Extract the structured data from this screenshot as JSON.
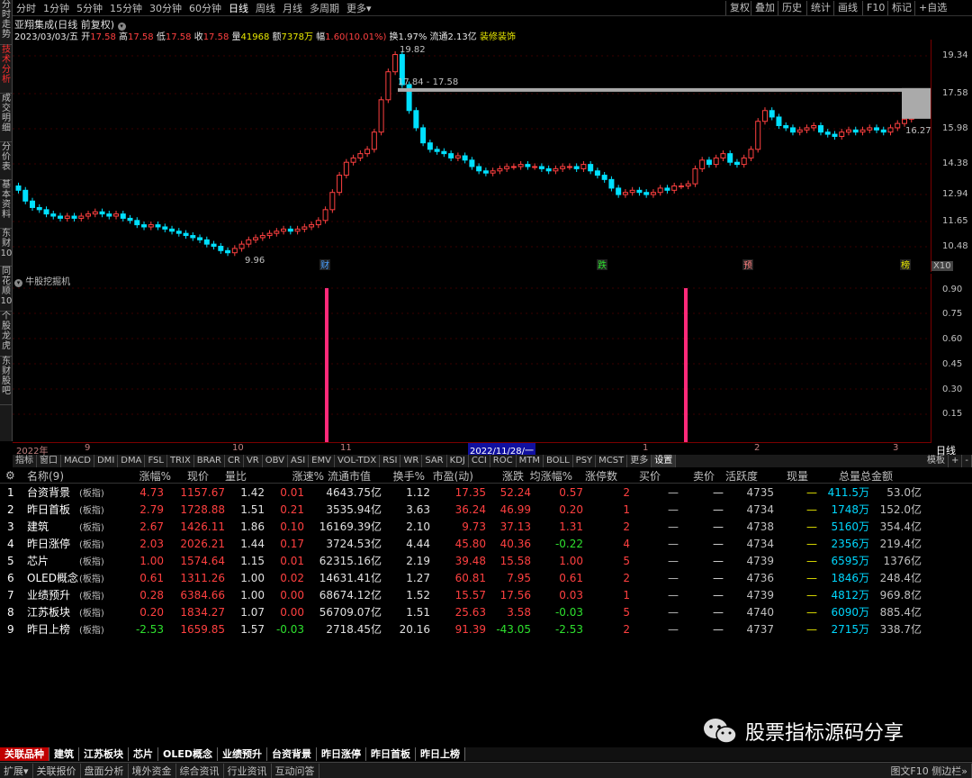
{
  "left_tabs": [
    "分时走势",
    "技术分析",
    "成交明细",
    "分价表",
    "基本资料",
    "东财10",
    "同花顺10",
    "个股龙虎",
    "东财股吧"
  ],
  "toolbar": {
    "periods": [
      "分时",
      "1分钟",
      "5分钟",
      "15分钟",
      "30分钟",
      "60分钟",
      "日线",
      "周线",
      "月线",
      "多周期",
      "更多▾"
    ],
    "active": "日线",
    "right": [
      "复权",
      "叠加",
      "历史",
      "统计",
      "画线",
      "F10",
      "标记",
      "+自选"
    ]
  },
  "stock": {
    "title": "亚翔集成(日线 前复权)",
    "date": "2023/03/03/五",
    "open_l": "开",
    "open": "17.58",
    "high_l": "高",
    "high": "17.58",
    "low_l": "低",
    "low": "17.58",
    "close_l": "收",
    "close": "17.58",
    "vol_l": "量",
    "vol": "41968",
    "amt_l": "额",
    "amt": "7378万",
    "chg_l": "幅",
    "chg": "1.60(10.01%)",
    "turn_l": "换",
    "turn": "1.97%",
    "float_l": "流通",
    "float": "2.13亿",
    "sector": "装修装饰"
  },
  "price_axis": [
    "19.34",
    "17.58",
    "15.98",
    "14.38",
    "12.94",
    "11.65",
    "10.48",
    "X10"
  ],
  "annotations": {
    "high": "19.82",
    "low": "9.96",
    "range": "17.84 - 17.58",
    "last": "16.27",
    "events": [
      "财",
      "跌",
      "预",
      "榜"
    ]
  },
  "indicator": {
    "title": "牛股挖掘机",
    "axis": [
      "0.90",
      "0.75",
      "0.60",
      "0.45",
      "0.30",
      "0.15"
    ]
  },
  "date_axis": [
    "2022年",
    "9",
    "10",
    "11",
    "2022/11/28/一",
    "1",
    "2",
    "3"
  ],
  "period_label": "日线",
  "ind_tabs": [
    "指标",
    "窗口",
    "MACD",
    "DMI",
    "DMA",
    "FSL",
    "TRIX",
    "BRAR",
    "CR",
    "VR",
    "OBV",
    "ASI",
    "EMV",
    "VOL-TDX",
    "RSI",
    "WR",
    "SAR",
    "KDJ",
    "CCI",
    "ROC",
    "MTM",
    "BOLL",
    "PSY",
    "MCST",
    "更多",
    "设置"
  ],
  "ind_tabs_right": [
    "模板",
    "+",
    "-"
  ],
  "table": {
    "headers": [
      "",
      "名称(9)",
      "涨幅%",
      "现价",
      "量比",
      "涨速%",
      "流通市值",
      "换手%",
      "市盈(动)",
      "涨跌",
      "均涨幅%",
      "涨停数",
      "买价",
      "卖价",
      "活跃度",
      "现量",
      "总量",
      "总金额"
    ],
    "rows": [
      [
        "1",
        "台资背景",
        "(板指)",
        "4.73",
        "1157.67",
        "1.42",
        "0.01",
        "4643.75亿",
        "1.12",
        "17.35",
        "52.24",
        "0.57",
        "2",
        "—",
        "—",
        "4735",
        "—",
        "411.5万",
        "53.0亿"
      ],
      [
        "2",
        "昨日首板",
        "(板指)",
        "2.79",
        "1728.88",
        "1.51",
        "0.21",
        "3535.94亿",
        "3.63",
        "36.24",
        "46.99",
        "0.20",
        "1",
        "—",
        "—",
        "4734",
        "—",
        "1748万",
        "152.0亿"
      ],
      [
        "3",
        "建筑",
        "(板指)",
        "2.67",
        "1426.11",
        "1.86",
        "0.10",
        "16169.39亿",
        "2.10",
        "9.73",
        "37.13",
        "1.31",
        "2",
        "—",
        "—",
        "4738",
        "—",
        "5160万",
        "354.4亿"
      ],
      [
        "4",
        "昨日涨停",
        "(板指)",
        "2.03",
        "2026.21",
        "1.44",
        "0.17",
        "3724.53亿",
        "4.44",
        "45.80",
        "40.36",
        "-0.22",
        "4",
        "—",
        "—",
        "4734",
        "—",
        "2356万",
        "219.4亿"
      ],
      [
        "5",
        "芯片",
        "(板指)",
        "1.00",
        "1574.64",
        "1.15",
        "0.01",
        "62315.16亿",
        "2.19",
        "39.48",
        "15.58",
        "1.00",
        "5",
        "—",
        "—",
        "4739",
        "—",
        "6595万",
        "1376亿"
      ],
      [
        "6",
        "OLED概念",
        "(板指)",
        "0.61",
        "1311.26",
        "1.00",
        "0.02",
        "14631.41亿",
        "1.27",
        "60.81",
        "7.95",
        "0.61",
        "2",
        "—",
        "—",
        "4736",
        "—",
        "1846万",
        "248.4亿"
      ],
      [
        "7",
        "业绩预升",
        "(板指)",
        "0.28",
        "6384.66",
        "1.00",
        "0.00",
        "68674.12亿",
        "1.52",
        "15.57",
        "17.56",
        "0.03",
        "1",
        "—",
        "—",
        "4739",
        "—",
        "4812万",
        "969.8亿"
      ],
      [
        "8",
        "江苏板块",
        "(板指)",
        "0.20",
        "1834.27",
        "1.07",
        "0.00",
        "56709.07亿",
        "1.51",
        "25.63",
        "3.58",
        "-0.03",
        "5",
        "—",
        "—",
        "4740",
        "—",
        "6090万",
        "885.4亿"
      ],
      [
        "9",
        "昨日上榜",
        "(板指)",
        "-2.53",
        "1659.85",
        "1.57",
        "-0.03",
        "2718.45亿",
        "20.16",
        "91.39",
        "-43.05",
        "-2.53",
        "2",
        "—",
        "—",
        "4737",
        "—",
        "2715万",
        "338.7亿"
      ]
    ]
  },
  "bottom_tabs": [
    "关联品种",
    "建筑",
    "江苏板块",
    "芯片",
    "OLED概念",
    "业绩预升",
    "台资背景",
    "昨日涨停",
    "昨日首板",
    "昨日上榜"
  ],
  "status": [
    "扩展▾",
    "关联报价",
    "盘面分析",
    "境外资金",
    "综合资讯",
    "行业资讯",
    "互动问答"
  ],
  "status_right": "图文F10 侧边栏»",
  "watermark": "股票指标源码分享",
  "colors": {
    "up": "#ff4040",
    "down": "#00e0ff",
    "signal": "#ff2a7a"
  }
}
